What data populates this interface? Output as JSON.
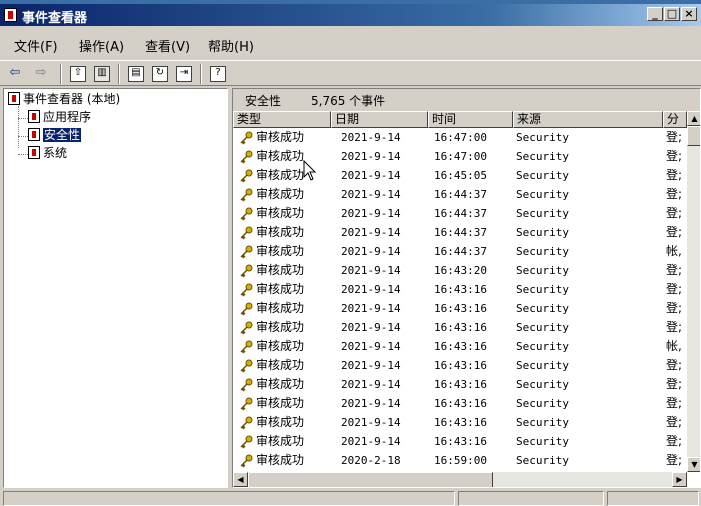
{
  "window": {
    "title": "事件查看器"
  },
  "menu": {
    "items": [
      "文件(F)",
      "操作(A)",
      "查看(V)",
      "帮助(H)"
    ]
  },
  "toolbar": {
    "buttons": [
      "back-icon",
      "forward-icon",
      "up-folder-icon",
      "show-tree-icon",
      "properties-icon",
      "refresh-icon",
      "export-icon",
      "help-icon"
    ]
  },
  "tree": {
    "root": "事件查看器 (本地)",
    "children": [
      "应用程序",
      "安全性",
      "系统"
    ],
    "selected": "安全性"
  },
  "pane": {
    "name": "安全性",
    "count": "5,765 个事件"
  },
  "columns": [
    "类型",
    "日期",
    "时间",
    "来源",
    "分"
  ],
  "events": [
    {
      "type": "审核成功",
      "date": "2021-9-14",
      "time": "16:47:00",
      "source": "Security",
      "cat": "登;"
    },
    {
      "type": "审核成功",
      "date": "2021-9-14",
      "time": "16:47:00",
      "source": "Security",
      "cat": "登;"
    },
    {
      "type": "审核成功",
      "date": "2021-9-14",
      "time": "16:45:05",
      "source": "Security",
      "cat": "登;"
    },
    {
      "type": "审核成功",
      "date": "2021-9-14",
      "time": "16:44:37",
      "source": "Security",
      "cat": "登;"
    },
    {
      "type": "审核成功",
      "date": "2021-9-14",
      "time": "16:44:37",
      "source": "Security",
      "cat": "登;"
    },
    {
      "type": "审核成功",
      "date": "2021-9-14",
      "time": "16:44:37",
      "source": "Security",
      "cat": "登;"
    },
    {
      "type": "审核成功",
      "date": "2021-9-14",
      "time": "16:44:37",
      "source": "Security",
      "cat": "帐,"
    },
    {
      "type": "审核成功",
      "date": "2021-9-14",
      "time": "16:43:20",
      "source": "Security",
      "cat": "登;"
    },
    {
      "type": "审核成功",
      "date": "2021-9-14",
      "time": "16:43:16",
      "source": "Security",
      "cat": "登;"
    },
    {
      "type": "审核成功",
      "date": "2021-9-14",
      "time": "16:43:16",
      "source": "Security",
      "cat": "登;"
    },
    {
      "type": "审核成功",
      "date": "2021-9-14",
      "time": "16:43:16",
      "source": "Security",
      "cat": "登;"
    },
    {
      "type": "审核成功",
      "date": "2021-9-14",
      "time": "16:43:16",
      "source": "Security",
      "cat": "帐,"
    },
    {
      "type": "审核成功",
      "date": "2021-9-14",
      "time": "16:43:16",
      "source": "Security",
      "cat": "登;"
    },
    {
      "type": "审核成功",
      "date": "2021-9-14",
      "time": "16:43:16",
      "source": "Security",
      "cat": "登;"
    },
    {
      "type": "审核成功",
      "date": "2021-9-14",
      "time": "16:43:16",
      "source": "Security",
      "cat": "登;"
    },
    {
      "type": "审核成功",
      "date": "2021-9-14",
      "time": "16:43:16",
      "source": "Security",
      "cat": "登;"
    },
    {
      "type": "审核成功",
      "date": "2021-9-14",
      "time": "16:43:16",
      "source": "Security",
      "cat": "登;"
    },
    {
      "type": "审核成功",
      "date": "2020-2-18",
      "time": "16:59:00",
      "source": "Security",
      "cat": "登;"
    }
  ],
  "colors": {
    "title_active": "#0a246a",
    "face": "#d4d0c8",
    "key_gold": "#d8b000"
  }
}
